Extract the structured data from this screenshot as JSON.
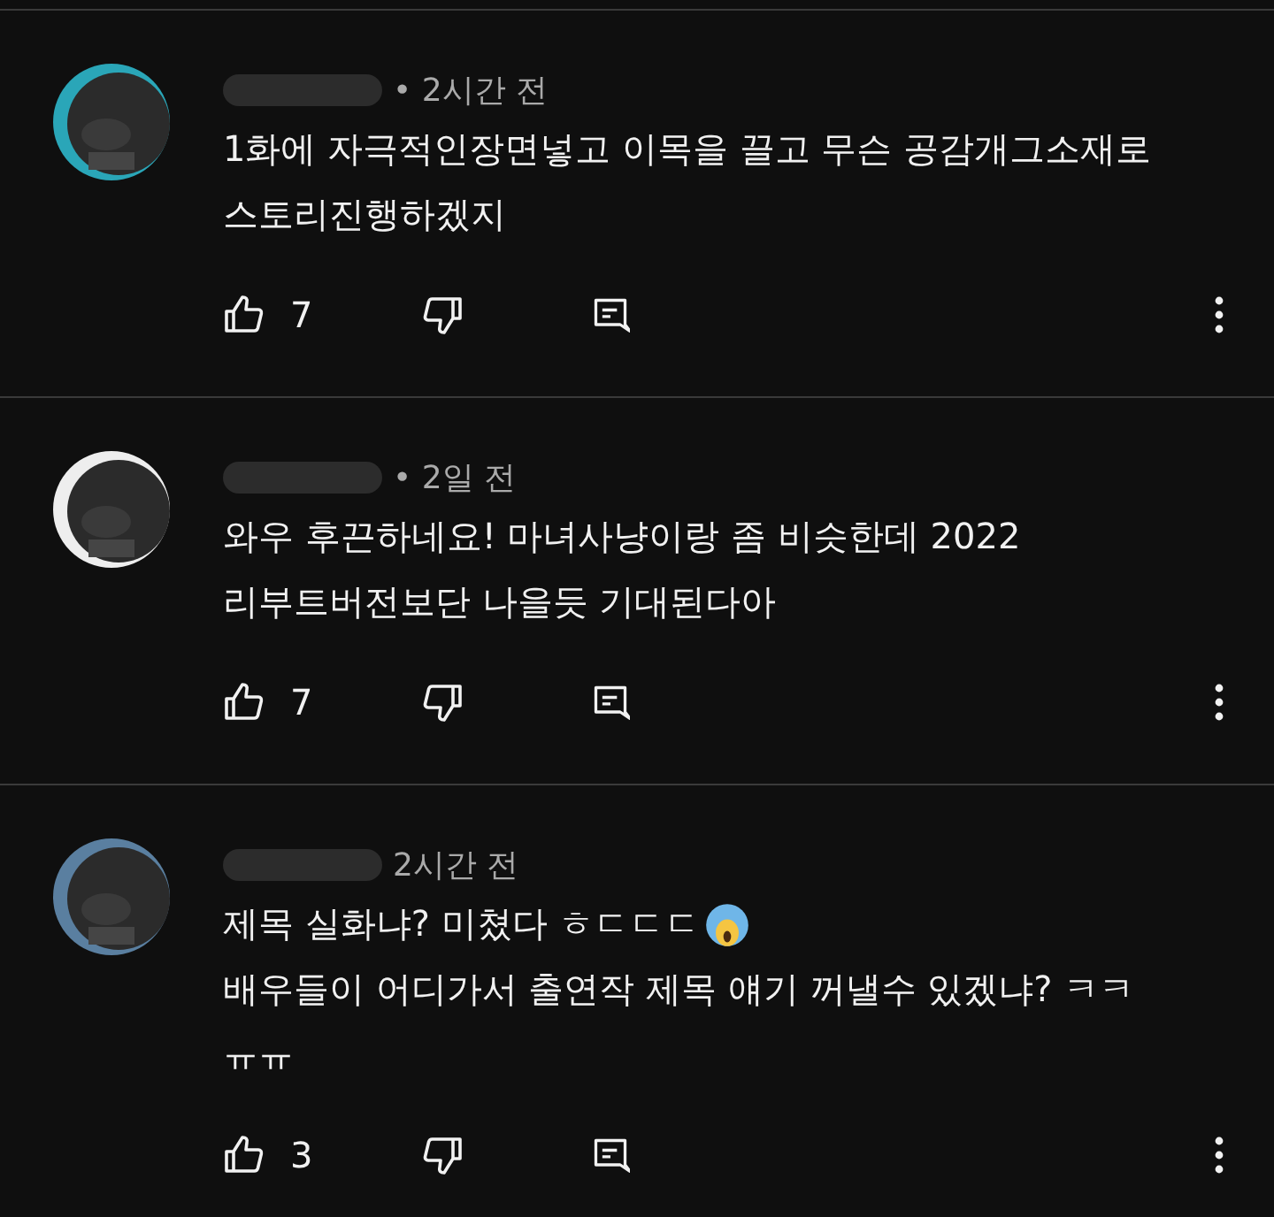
{
  "comments": [
    {
      "meta": "• 2시간 전",
      "lines": [
        "1화에 자극적인장면넣고 이목을 끌고 무슨 공감개그소재로",
        "스토리진행하겠지"
      ],
      "emoji_after_first_line": false,
      "likes": "7"
    },
    {
      "meta": "• 2일 전",
      "lines": [
        "와우 후끈하네요! 마녀사냥이랑 좀 비슷한데 2022",
        "리부트버전보단 나을듯 기대된다아"
      ],
      "emoji_after_first_line": false,
      "likes": "7"
    },
    {
      "meta": "2시간 전",
      "lines": [
        "제목 실화냐? 미쳤다 ㅎㄷㄷㄷ",
        "배우들이 어디가서 출연작 제목 얘기 꺼낼수 있겠냐? ㅋㅋ",
        "ㅠㅠ"
      ],
      "emoji_after_first_line": true,
      "likes": "3"
    }
  ]
}
